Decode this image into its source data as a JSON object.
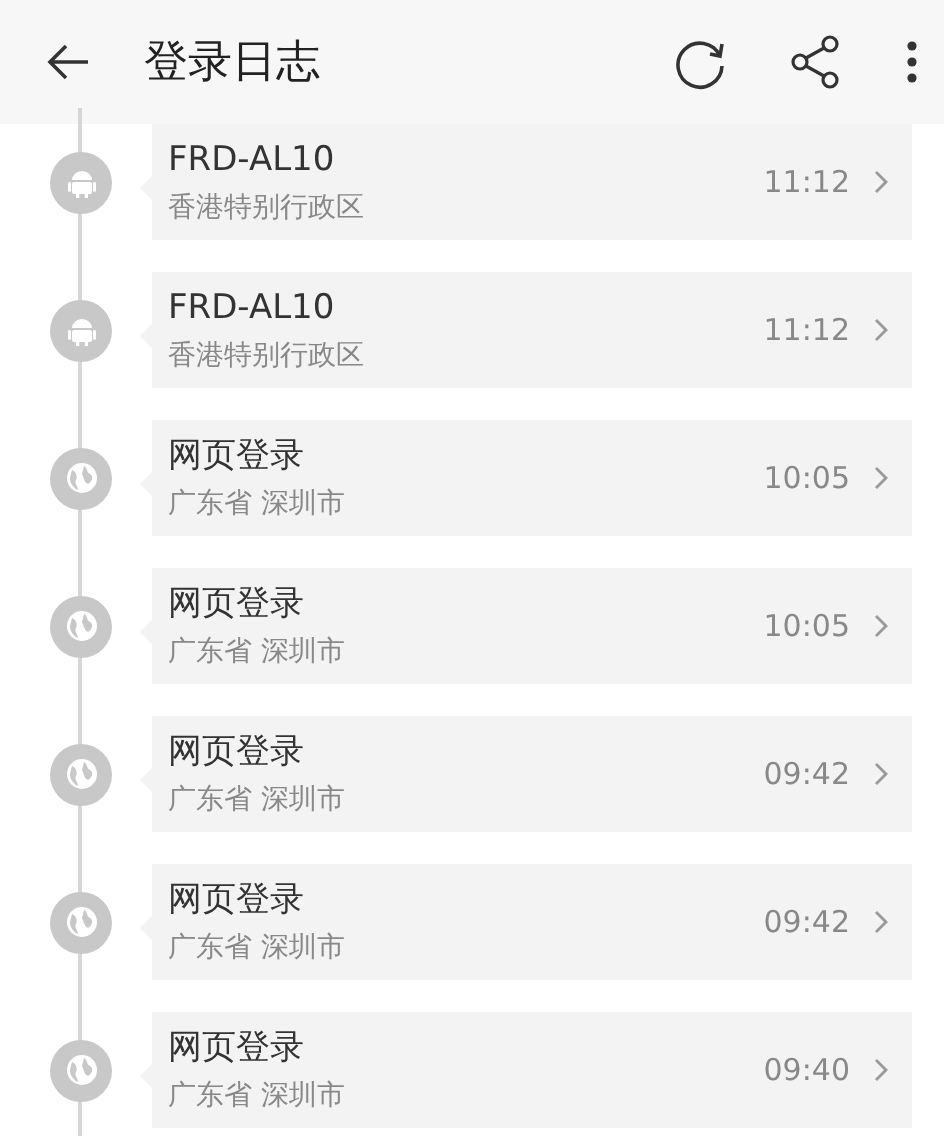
{
  "header": {
    "title": "登录日志"
  },
  "entries": [
    {
      "kind": "android",
      "device": "FRD-AL10",
      "location": "香港特别行政区",
      "time": "11:12"
    },
    {
      "kind": "android",
      "device": "FRD-AL10",
      "location": "香港特别行政区",
      "time": "11:12"
    },
    {
      "kind": "web",
      "device": "网页登录",
      "location": "广东省 深圳市",
      "time": "10:05"
    },
    {
      "kind": "web",
      "device": "网页登录",
      "location": "广东省 深圳市",
      "time": "10:05"
    },
    {
      "kind": "web",
      "device": "网页登录",
      "location": "广东省 深圳市",
      "time": "09:42"
    },
    {
      "kind": "web",
      "device": "网页登录",
      "location": "广东省 深圳市",
      "time": "09:42"
    },
    {
      "kind": "web",
      "device": "网页登录",
      "location": "广东省 深圳市",
      "time": "09:40"
    }
  ]
}
